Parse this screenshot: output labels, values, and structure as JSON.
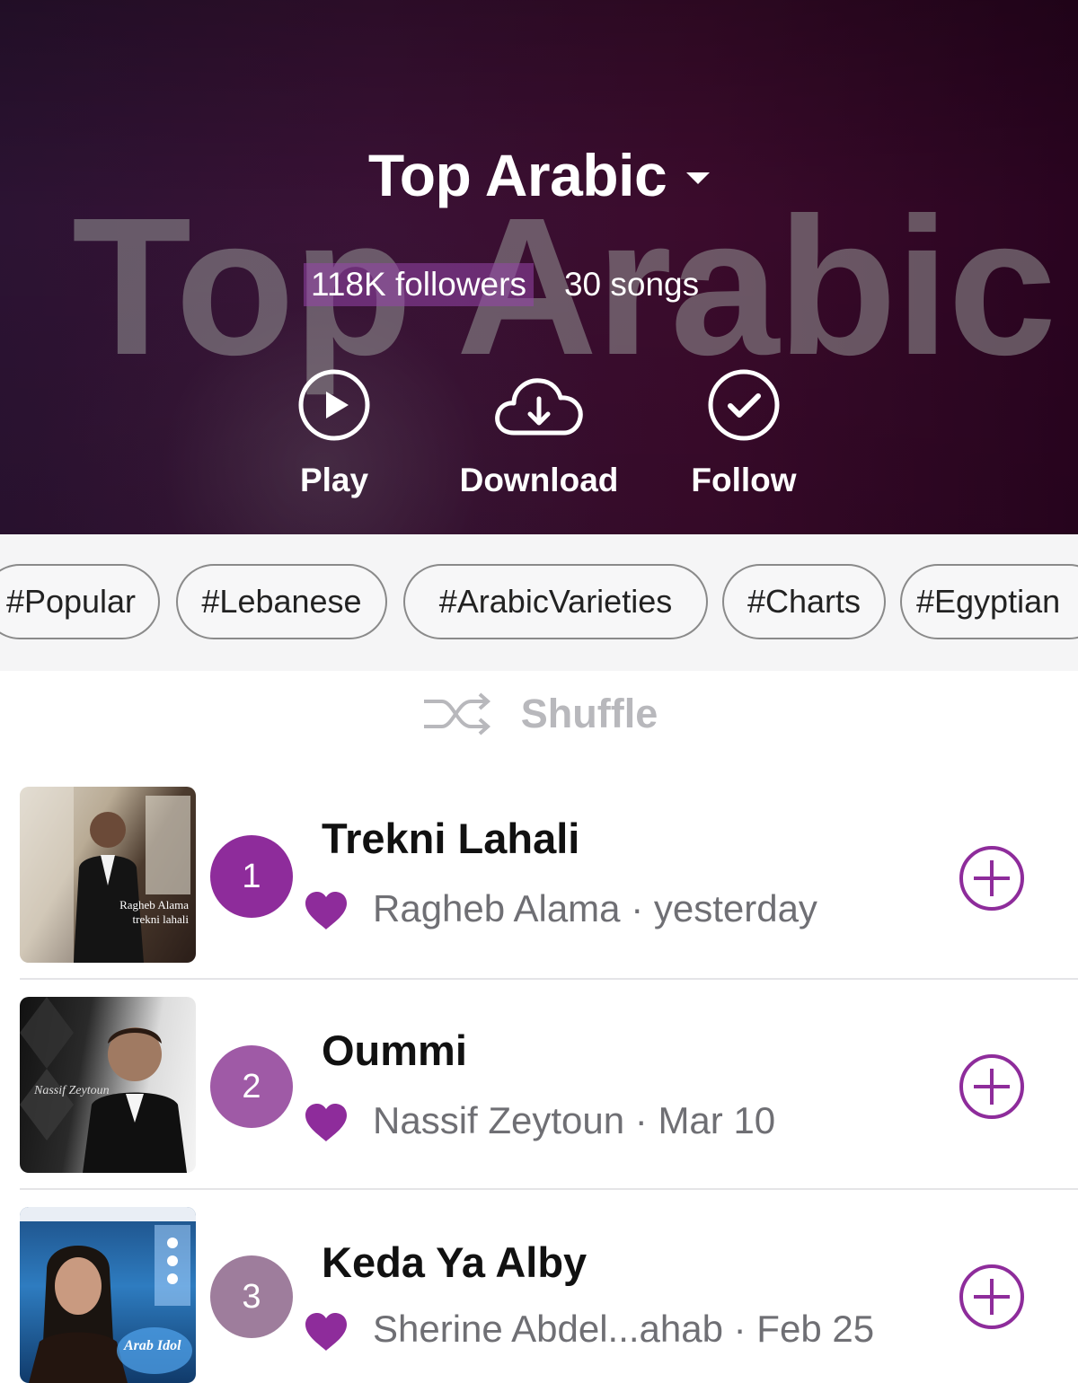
{
  "header": {
    "title": "Top Arabic",
    "watermark": "Top Arabic",
    "followers": "118K followers",
    "songs": "30 songs",
    "actions": [
      {
        "label": "Play",
        "icon": "play-circle-icon"
      },
      {
        "label": "Download",
        "icon": "cloud-download-icon"
      },
      {
        "label": "Follow",
        "icon": "check-circle-icon"
      }
    ]
  },
  "tags": [
    "#Popular",
    "#Lebanese",
    "#ArabicVarieties",
    "#Charts",
    "#Egyptian"
  ],
  "shuffle": {
    "label": "Shuffle",
    "icon": "shuffle-icon"
  },
  "songs": [
    {
      "rank": "1",
      "title": "Trekni Lahali",
      "meta": "Ragheb Alama · yesterday",
      "cover_text": "Ragheb Alama trekni lahali"
    },
    {
      "rank": "2",
      "title": "Oummi",
      "meta": "Nassif Zeytoun · Mar 10",
      "cover_text": "Nassif Zeytoun"
    },
    {
      "rank": "3",
      "title": "Keda Ya Alby",
      "meta": "Sherine Abdel...ahab · Feb 25",
      "cover_text": "Arab Idol"
    }
  ],
  "colors": {
    "accent": "#8e2c9b",
    "rank1": "#8e2c9b",
    "rank2": "#9f5aa6",
    "rank3": "#9e7d9c",
    "heart": "#8e2c9b"
  }
}
